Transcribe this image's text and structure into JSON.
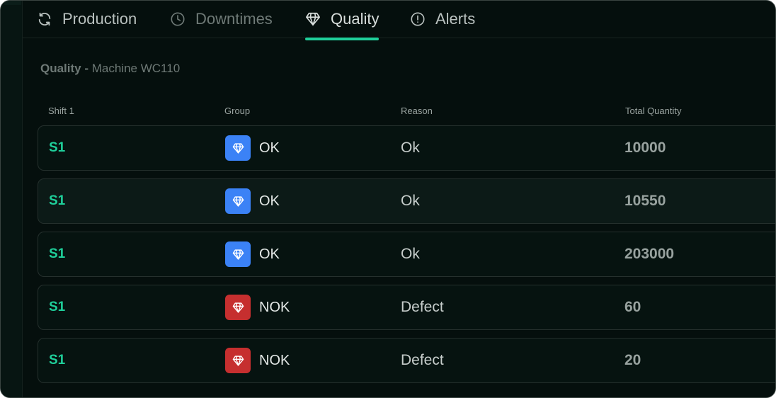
{
  "tabs": [
    {
      "label": "Production",
      "icon": "refresh-icon",
      "state": "normal"
    },
    {
      "label": "Downtimes",
      "icon": "clock-icon",
      "state": "muted"
    },
    {
      "label": "Quality",
      "icon": "diamond-icon",
      "state": "active"
    },
    {
      "label": "Alerts",
      "icon": "alert-circle-icon",
      "state": "normal"
    }
  ],
  "section": {
    "title_bold": "Quality -",
    "title_rest": " Machine WC110"
  },
  "columns": {
    "shift": "Shift 1",
    "group": "Group",
    "reason": "Reason",
    "total": "Total Quantity"
  },
  "rows": [
    {
      "shift": "S1",
      "group": "OK",
      "status": "ok",
      "reason": "Ok",
      "quantity": "10000"
    },
    {
      "shift": "S1",
      "group": "OK",
      "status": "ok",
      "reason": "Ok",
      "quantity": "10550"
    },
    {
      "shift": "S1",
      "group": "OK",
      "status": "ok",
      "reason": "Ok",
      "quantity": "203000"
    },
    {
      "shift": "S1",
      "group": "NOK",
      "status": "nok",
      "reason": "Defect",
      "quantity": "60"
    },
    {
      "shift": "S1",
      "group": "NOK",
      "status": "nok",
      "reason": "Defect",
      "quantity": "20"
    }
  ],
  "colors": {
    "accent": "#1fcf9a",
    "ok": "#3b82f6",
    "nok": "#c62f2f",
    "background": "#050f0d"
  }
}
